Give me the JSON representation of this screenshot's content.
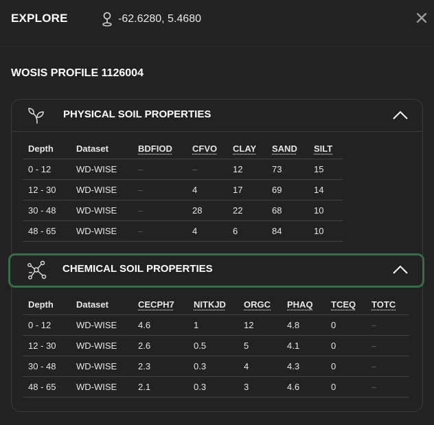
{
  "header": {
    "title": "EXPLORE",
    "coordinates": "-62.6280, 5.4680",
    "close_icon": "close-icon",
    "location_icon": "map-pin-icon"
  },
  "profile": {
    "title": "WOSIS PROFILE 1126004"
  },
  "physical": {
    "title": "PHYSICAL SOIL PROPERTIES",
    "icon": "sprout-icon",
    "columns": [
      "Depth",
      "Dataset",
      "BDFIOD",
      "CFVO",
      "CLAY",
      "SAND",
      "SILT"
    ],
    "rows": [
      [
        "0 - 12",
        "WD-WISE",
        "–",
        "–",
        "12",
        "73",
        "15"
      ],
      [
        "12 - 30",
        "WD-WISE",
        "–",
        "4",
        "17",
        "69",
        "14"
      ],
      [
        "30 - 48",
        "WD-WISE",
        "–",
        "28",
        "22",
        "68",
        "10"
      ],
      [
        "48 - 65",
        "WD-WISE",
        "–",
        "4",
        "6",
        "84",
        "10"
      ]
    ]
  },
  "chemical": {
    "title": "CHEMICAL SOIL PROPERTIES",
    "icon": "molecule-icon",
    "columns": [
      "Depth",
      "Dataset",
      "CECPH7",
      "NITKJD",
      "ORGC",
      "PHAQ",
      "TCEQ",
      "TOTC"
    ],
    "rows": [
      [
        "0 - 12",
        "WD-WISE",
        "4.6",
        "1",
        "12",
        "4.8",
        "0",
        "–"
      ],
      [
        "12 - 30",
        "WD-WISE",
        "2.6",
        "0.5",
        "5",
        "4.1",
        "0",
        "–"
      ],
      [
        "30 - 48",
        "WD-WISE",
        "2.3",
        "0.3",
        "4",
        "4.3",
        "0",
        "–"
      ],
      [
        "48 - 65",
        "WD-WISE",
        "2.1",
        "0.3",
        "3",
        "4.6",
        "0",
        "–"
      ]
    ]
  },
  "colors": {
    "background": "#222222",
    "accent_border": "#3c6b49",
    "muted_dash": "#5f5f5f"
  }
}
